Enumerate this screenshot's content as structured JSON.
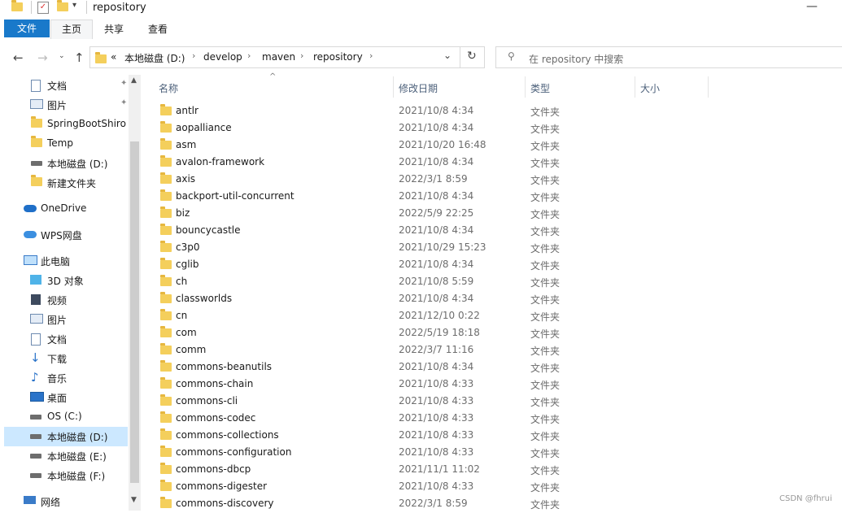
{
  "window": {
    "title": "repository"
  },
  "ribbon": {
    "file": "文件",
    "home": "主页",
    "share": "共享",
    "view": "查看"
  },
  "address": {
    "parts": [
      "本地磁盘 (D:)",
      "develop",
      "maven",
      "repository"
    ],
    "overflow": "«"
  },
  "search": {
    "placeholder": "在 repository 中搜索"
  },
  "sidebar": {
    "quick": [
      {
        "label": "文档",
        "icon": "document-icon",
        "pinned": true
      },
      {
        "label": "图片",
        "icon": "picture-icon",
        "pinned": true
      },
      {
        "label": "SpringBootShiro",
        "icon": "folder-icon"
      },
      {
        "label": "Temp",
        "icon": "folder-icon"
      },
      {
        "label": "本地磁盘 (D:)",
        "icon": "drive-icon"
      },
      {
        "label": "新建文件夹",
        "icon": "folder-icon"
      }
    ],
    "onedrive": "OneDrive",
    "wps": "WPS网盘",
    "thispc": "此电脑",
    "pc_items": [
      {
        "label": "3D 对象",
        "icon": "3d-objects-icon"
      },
      {
        "label": "视频",
        "icon": "video-icon"
      },
      {
        "label": "图片",
        "icon": "picture-icon"
      },
      {
        "label": "文档",
        "icon": "document-icon"
      },
      {
        "label": "下载",
        "icon": "download-icon"
      },
      {
        "label": "音乐",
        "icon": "music-icon"
      },
      {
        "label": "桌面",
        "icon": "desktop-icon"
      },
      {
        "label": "OS (C:)",
        "icon": "drive-icon"
      },
      {
        "label": "本地磁盘 (D:)",
        "icon": "drive-icon",
        "selected": true
      },
      {
        "label": "本地磁盘 (E:)",
        "icon": "drive-icon"
      },
      {
        "label": "本地磁盘 (F:)",
        "icon": "drive-icon"
      }
    ],
    "network": "网络"
  },
  "columns": {
    "name": "名称",
    "date": "修改日期",
    "type": "类型",
    "size": "大小"
  },
  "files": [
    {
      "name": "antlr",
      "date": "2021/10/8 4:34",
      "type": "文件夹"
    },
    {
      "name": "aopalliance",
      "date": "2021/10/8 4:34",
      "type": "文件夹"
    },
    {
      "name": "asm",
      "date": "2021/10/20 16:48",
      "type": "文件夹"
    },
    {
      "name": "avalon-framework",
      "date": "2021/10/8 4:34",
      "type": "文件夹"
    },
    {
      "name": "axis",
      "date": "2022/3/1 8:59",
      "type": "文件夹"
    },
    {
      "name": "backport-util-concurrent",
      "date": "2021/10/8 4:34",
      "type": "文件夹"
    },
    {
      "name": "biz",
      "date": "2022/5/9 22:25",
      "type": "文件夹"
    },
    {
      "name": "bouncycastle",
      "date": "2021/10/8 4:34",
      "type": "文件夹"
    },
    {
      "name": "c3p0",
      "date": "2021/10/29 15:23",
      "type": "文件夹"
    },
    {
      "name": "cglib",
      "date": "2021/10/8 4:34",
      "type": "文件夹"
    },
    {
      "name": "ch",
      "date": "2021/10/8 5:59",
      "type": "文件夹"
    },
    {
      "name": "classworlds",
      "date": "2021/10/8 4:34",
      "type": "文件夹"
    },
    {
      "name": "cn",
      "date": "2021/12/10 0:22",
      "type": "文件夹"
    },
    {
      "name": "com",
      "date": "2022/5/19 18:18",
      "type": "文件夹"
    },
    {
      "name": "comm",
      "date": "2022/3/7 11:16",
      "type": "文件夹"
    },
    {
      "name": "commons-beanutils",
      "date": "2021/10/8 4:34",
      "type": "文件夹"
    },
    {
      "name": "commons-chain",
      "date": "2021/10/8 4:33",
      "type": "文件夹"
    },
    {
      "name": "commons-cli",
      "date": "2021/10/8 4:33",
      "type": "文件夹"
    },
    {
      "name": "commons-codec",
      "date": "2021/10/8 4:33",
      "type": "文件夹"
    },
    {
      "name": "commons-collections",
      "date": "2021/10/8 4:33",
      "type": "文件夹"
    },
    {
      "name": "commons-configuration",
      "date": "2021/10/8 4:33",
      "type": "文件夹"
    },
    {
      "name": "commons-dbcp",
      "date": "2021/11/1 11:02",
      "type": "文件夹"
    },
    {
      "name": "commons-digester",
      "date": "2021/10/8 4:33",
      "type": "文件夹"
    },
    {
      "name": "commons-discovery",
      "date": "2022/3/1 8:59",
      "type": "文件夹"
    }
  ],
  "watermark": "CSDN @fhrui",
  "colors": {
    "accent": "#1979ca",
    "selection": "#cce8ff",
    "folder": "#f4cf5c"
  }
}
